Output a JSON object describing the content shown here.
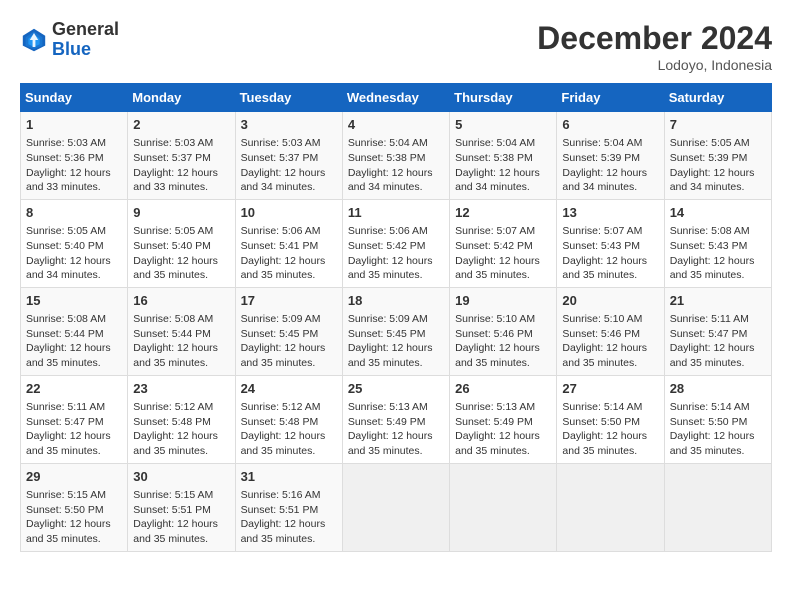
{
  "header": {
    "logo_general": "General",
    "logo_blue": "Blue",
    "month_title": "December 2024",
    "location": "Lodoyo, Indonesia"
  },
  "weekdays": [
    "Sunday",
    "Monday",
    "Tuesday",
    "Wednesday",
    "Thursday",
    "Friday",
    "Saturday"
  ],
  "weeks": [
    [
      {
        "day": "1",
        "lines": [
          "Sunrise: 5:03 AM",
          "Sunset: 5:36 PM",
          "Daylight: 12 hours",
          "and 33 minutes."
        ]
      },
      {
        "day": "2",
        "lines": [
          "Sunrise: 5:03 AM",
          "Sunset: 5:37 PM",
          "Daylight: 12 hours",
          "and 33 minutes."
        ]
      },
      {
        "day": "3",
        "lines": [
          "Sunrise: 5:03 AM",
          "Sunset: 5:37 PM",
          "Daylight: 12 hours",
          "and 34 minutes."
        ]
      },
      {
        "day": "4",
        "lines": [
          "Sunrise: 5:04 AM",
          "Sunset: 5:38 PM",
          "Daylight: 12 hours",
          "and 34 minutes."
        ]
      },
      {
        "day": "5",
        "lines": [
          "Sunrise: 5:04 AM",
          "Sunset: 5:38 PM",
          "Daylight: 12 hours",
          "and 34 minutes."
        ]
      },
      {
        "day": "6",
        "lines": [
          "Sunrise: 5:04 AM",
          "Sunset: 5:39 PM",
          "Daylight: 12 hours",
          "and 34 minutes."
        ]
      },
      {
        "day": "7",
        "lines": [
          "Sunrise: 5:05 AM",
          "Sunset: 5:39 PM",
          "Daylight: 12 hours",
          "and 34 minutes."
        ]
      }
    ],
    [
      {
        "day": "8",
        "lines": [
          "Sunrise: 5:05 AM",
          "Sunset: 5:40 PM",
          "Daylight: 12 hours",
          "and 34 minutes."
        ]
      },
      {
        "day": "9",
        "lines": [
          "Sunrise: 5:05 AM",
          "Sunset: 5:40 PM",
          "Daylight: 12 hours",
          "and 35 minutes."
        ]
      },
      {
        "day": "10",
        "lines": [
          "Sunrise: 5:06 AM",
          "Sunset: 5:41 PM",
          "Daylight: 12 hours",
          "and 35 minutes."
        ]
      },
      {
        "day": "11",
        "lines": [
          "Sunrise: 5:06 AM",
          "Sunset: 5:42 PM",
          "Daylight: 12 hours",
          "and 35 minutes."
        ]
      },
      {
        "day": "12",
        "lines": [
          "Sunrise: 5:07 AM",
          "Sunset: 5:42 PM",
          "Daylight: 12 hours",
          "and 35 minutes."
        ]
      },
      {
        "day": "13",
        "lines": [
          "Sunrise: 5:07 AM",
          "Sunset: 5:43 PM",
          "Daylight: 12 hours",
          "and 35 minutes."
        ]
      },
      {
        "day": "14",
        "lines": [
          "Sunrise: 5:08 AM",
          "Sunset: 5:43 PM",
          "Daylight: 12 hours",
          "and 35 minutes."
        ]
      }
    ],
    [
      {
        "day": "15",
        "lines": [
          "Sunrise: 5:08 AM",
          "Sunset: 5:44 PM",
          "Daylight: 12 hours",
          "and 35 minutes."
        ]
      },
      {
        "day": "16",
        "lines": [
          "Sunrise: 5:08 AM",
          "Sunset: 5:44 PM",
          "Daylight: 12 hours",
          "and 35 minutes."
        ]
      },
      {
        "day": "17",
        "lines": [
          "Sunrise: 5:09 AM",
          "Sunset: 5:45 PM",
          "Daylight: 12 hours",
          "and 35 minutes."
        ]
      },
      {
        "day": "18",
        "lines": [
          "Sunrise: 5:09 AM",
          "Sunset: 5:45 PM",
          "Daylight: 12 hours",
          "and 35 minutes."
        ]
      },
      {
        "day": "19",
        "lines": [
          "Sunrise: 5:10 AM",
          "Sunset: 5:46 PM",
          "Daylight: 12 hours",
          "and 35 minutes."
        ]
      },
      {
        "day": "20",
        "lines": [
          "Sunrise: 5:10 AM",
          "Sunset: 5:46 PM",
          "Daylight: 12 hours",
          "and 35 minutes."
        ]
      },
      {
        "day": "21",
        "lines": [
          "Sunrise: 5:11 AM",
          "Sunset: 5:47 PM",
          "Daylight: 12 hours",
          "and 35 minutes."
        ]
      }
    ],
    [
      {
        "day": "22",
        "lines": [
          "Sunrise: 5:11 AM",
          "Sunset: 5:47 PM",
          "Daylight: 12 hours",
          "and 35 minutes."
        ]
      },
      {
        "day": "23",
        "lines": [
          "Sunrise: 5:12 AM",
          "Sunset: 5:48 PM",
          "Daylight: 12 hours",
          "and 35 minutes."
        ]
      },
      {
        "day": "24",
        "lines": [
          "Sunrise: 5:12 AM",
          "Sunset: 5:48 PM",
          "Daylight: 12 hours",
          "and 35 minutes."
        ]
      },
      {
        "day": "25",
        "lines": [
          "Sunrise: 5:13 AM",
          "Sunset: 5:49 PM",
          "Daylight: 12 hours",
          "and 35 minutes."
        ]
      },
      {
        "day": "26",
        "lines": [
          "Sunrise: 5:13 AM",
          "Sunset: 5:49 PM",
          "Daylight: 12 hours",
          "and 35 minutes."
        ]
      },
      {
        "day": "27",
        "lines": [
          "Sunrise: 5:14 AM",
          "Sunset: 5:50 PM",
          "Daylight: 12 hours",
          "and 35 minutes."
        ]
      },
      {
        "day": "28",
        "lines": [
          "Sunrise: 5:14 AM",
          "Sunset: 5:50 PM",
          "Daylight: 12 hours",
          "and 35 minutes."
        ]
      }
    ],
    [
      {
        "day": "29",
        "lines": [
          "Sunrise: 5:15 AM",
          "Sunset: 5:50 PM",
          "Daylight: 12 hours",
          "and 35 minutes."
        ]
      },
      {
        "day": "30",
        "lines": [
          "Sunrise: 5:15 AM",
          "Sunset: 5:51 PM",
          "Daylight: 12 hours",
          "and 35 minutes."
        ]
      },
      {
        "day": "31",
        "lines": [
          "Sunrise: 5:16 AM",
          "Sunset: 5:51 PM",
          "Daylight: 12 hours",
          "and 35 minutes."
        ]
      },
      null,
      null,
      null,
      null
    ]
  ]
}
